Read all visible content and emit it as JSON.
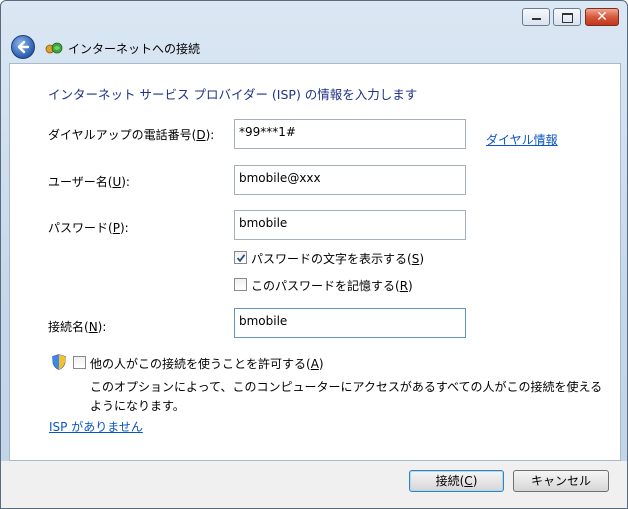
{
  "window": {
    "nav_title": "インターネットへの接続",
    "caption_buttons": {
      "minimize": "minimize-icon",
      "maximize": "maximize-icon",
      "close": "close-icon"
    }
  },
  "form": {
    "heading": "インターネット サービス プロバイダー (ISP) の情報を入力します",
    "phone": {
      "label": "ダイヤルアップの電話番号(",
      "key": "D",
      "suffix": "):",
      "value": "*99***1#"
    },
    "dial_info_link": "ダイヤル情報",
    "username": {
      "label": "ユーザー名(",
      "key": "U",
      "suffix": "):",
      "value": "bmobile@xxx"
    },
    "password": {
      "label": "パスワード(",
      "key": "P",
      "suffix": "):",
      "value": "bmobile"
    },
    "show_chars": {
      "label": "パスワードの文字を表示する(",
      "key": "S",
      "suffix": ")",
      "checked": true
    },
    "remember": {
      "label": "このパスワードを記憶する(",
      "key": "R",
      "suffix": ")",
      "checked": false
    },
    "conn_name": {
      "label": "接続名(",
      "key": "N",
      "suffix": "):",
      "value": "bmobile"
    },
    "allow_others": {
      "label": "他の人がこの接続を使うことを許可する(",
      "key": "A",
      "suffix": ")",
      "checked": false
    },
    "allow_desc": "このオプションによって、このコンピューターにアクセスがあるすべての人がこの接続を使えるようになります。",
    "no_isp_link": "ISP がありません"
  },
  "footer": {
    "connect": {
      "label": "接続(",
      "key": "C",
      "suffix": ")"
    },
    "cancel": "キャンセル"
  }
}
